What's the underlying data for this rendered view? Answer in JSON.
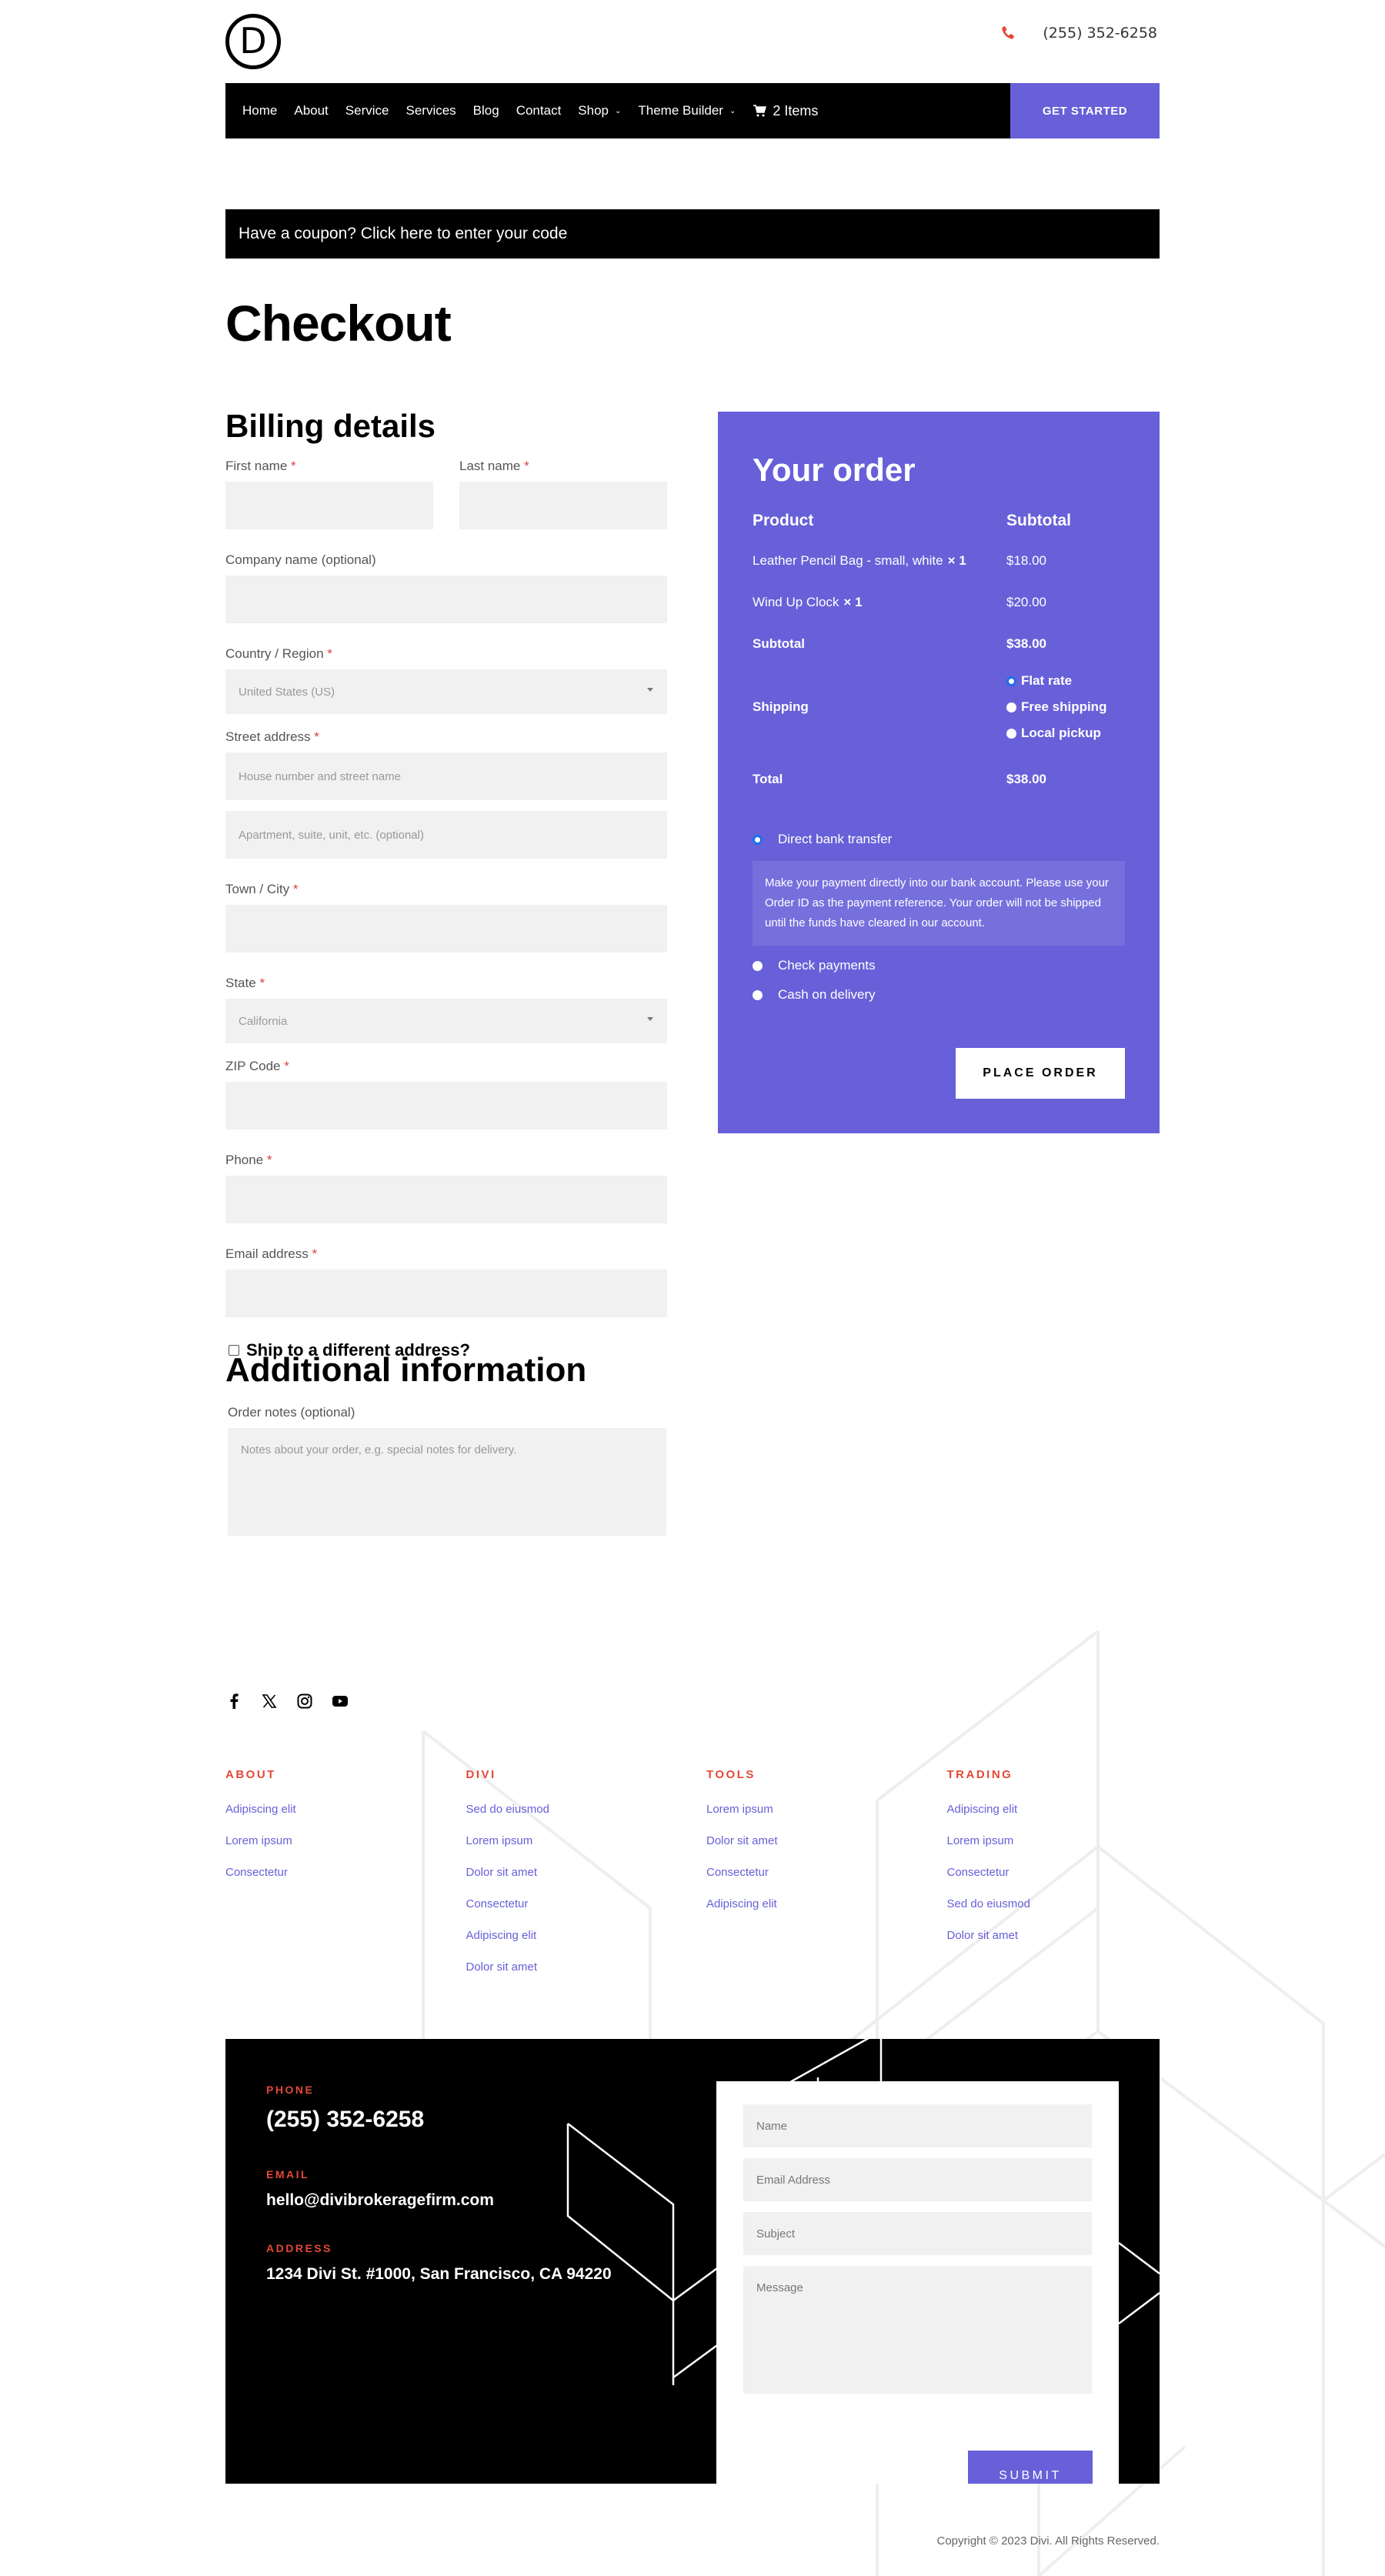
{
  "header": {
    "logo_letter": "D",
    "phone": "(255) 352-6258",
    "nav": [
      {
        "label": "Home",
        "has_dropdown": false
      },
      {
        "label": "About",
        "has_dropdown": false
      },
      {
        "label": "Service",
        "has_dropdown": false
      },
      {
        "label": "Services",
        "has_dropdown": false
      },
      {
        "label": "Blog",
        "has_dropdown": false
      },
      {
        "label": "Contact",
        "has_dropdown": false
      },
      {
        "label": "Shop",
        "has_dropdown": true
      },
      {
        "label": "Theme Builder",
        "has_dropdown": true
      }
    ],
    "cart_label": "2 Items",
    "cta_label": "GET STARTED"
  },
  "coupon_notice": "Have a coupon? Click here to enter your code",
  "page_title": "Checkout",
  "billing": {
    "title": "Billing details",
    "first_name": {
      "label": "First name",
      "value": ""
    },
    "last_name": {
      "label": "Last name",
      "value": ""
    },
    "company": {
      "label": "Company name (optional)",
      "value": ""
    },
    "country": {
      "label": "Country / Region",
      "value": "United States (US)"
    },
    "street": {
      "label": "Street address",
      "placeholder1": "House number and street name",
      "placeholder2": "Apartment, suite, unit, etc. (optional)"
    },
    "city": {
      "label": "Town / City",
      "value": ""
    },
    "state": {
      "label": "State",
      "value": "California"
    },
    "zip": {
      "label": "ZIP Code",
      "value": ""
    },
    "phone": {
      "label": "Phone",
      "value": ""
    },
    "email": {
      "label": "Email address",
      "value": ""
    },
    "required_mark": "*",
    "ship_different": "Ship to a different address?"
  },
  "additional": {
    "title": "Additional information",
    "notes_label": "Order notes (optional)",
    "notes_placeholder": "Notes about your order, e.g. special notes for delivery."
  },
  "order": {
    "title": "Your order",
    "col_product": "Product",
    "col_subtotal": "Subtotal",
    "items": [
      {
        "name": "Leather Pencil Bag - small, white",
        "qty": "× 1",
        "price": "$18.00"
      },
      {
        "name": "Wind Up Clock",
        "qty": "× 1",
        "price": "$20.00"
      }
    ],
    "subtotal_label": "Subtotal",
    "subtotal_value": "$38.00",
    "shipping_label": "Shipping",
    "shipping_options": [
      {
        "label": "Flat rate",
        "selected": true
      },
      {
        "label": "Free shipping",
        "selected": false
      },
      {
        "label": "Local pickup",
        "selected": false
      }
    ],
    "total_label": "Total",
    "total_value": "$38.00",
    "payment_methods": [
      {
        "label": "Direct bank transfer",
        "selected": true
      },
      {
        "label": "Check payments",
        "selected": false
      },
      {
        "label": "Cash on delivery",
        "selected": false
      }
    ],
    "bank_description": "Make your payment directly into our bank account. Please use your Order ID as the payment reference. Your order will not be shipped until the funds have cleared in our account.",
    "place_order_label": "PLACE ORDER"
  },
  "footer": {
    "social": [
      "facebook",
      "x",
      "instagram",
      "youtube"
    ],
    "columns": [
      {
        "title": "ABOUT",
        "links": [
          "Adipiscing elit",
          "Lorem ipsum",
          "Consectetur"
        ]
      },
      {
        "title": "DIVI",
        "links": [
          "Sed do eiusmod",
          "Lorem ipsum",
          "Dolor sit amet",
          "Consectetur",
          "Adipiscing elit",
          "Dolor sit amet"
        ]
      },
      {
        "title": "TOOLS",
        "links": [
          "Lorem ipsum",
          "Dolor sit amet",
          "Consectetur",
          "Adipiscing elit"
        ]
      },
      {
        "title": "TRADING",
        "links": [
          "Adipiscing elit",
          "Lorem ipsum",
          "Consectetur",
          "Sed do eiusmod",
          "Dolor sit amet"
        ]
      }
    ],
    "contact": {
      "phone_label": "PHONE",
      "phone": "(255) 352-6258",
      "email_label": "EMAIL",
      "email": "hello@divibrokeragefirm.com",
      "address_label": "ADDRESS",
      "address": "1234 Divi St. #1000, San Francisco, CA 94220"
    },
    "form": {
      "name_placeholder": "Name",
      "email_placeholder": "Email Address",
      "subject_placeholder": "Subject",
      "message_placeholder": "Message",
      "submit_label": "SUBMIT"
    },
    "copyright": "Copyright © 2023 Divi. All Rights Reserved."
  },
  "colors": {
    "accent": "#6760d8",
    "highlight": "#e24a36",
    "dark": "#000000",
    "field_bg": "#f1f1f1"
  }
}
